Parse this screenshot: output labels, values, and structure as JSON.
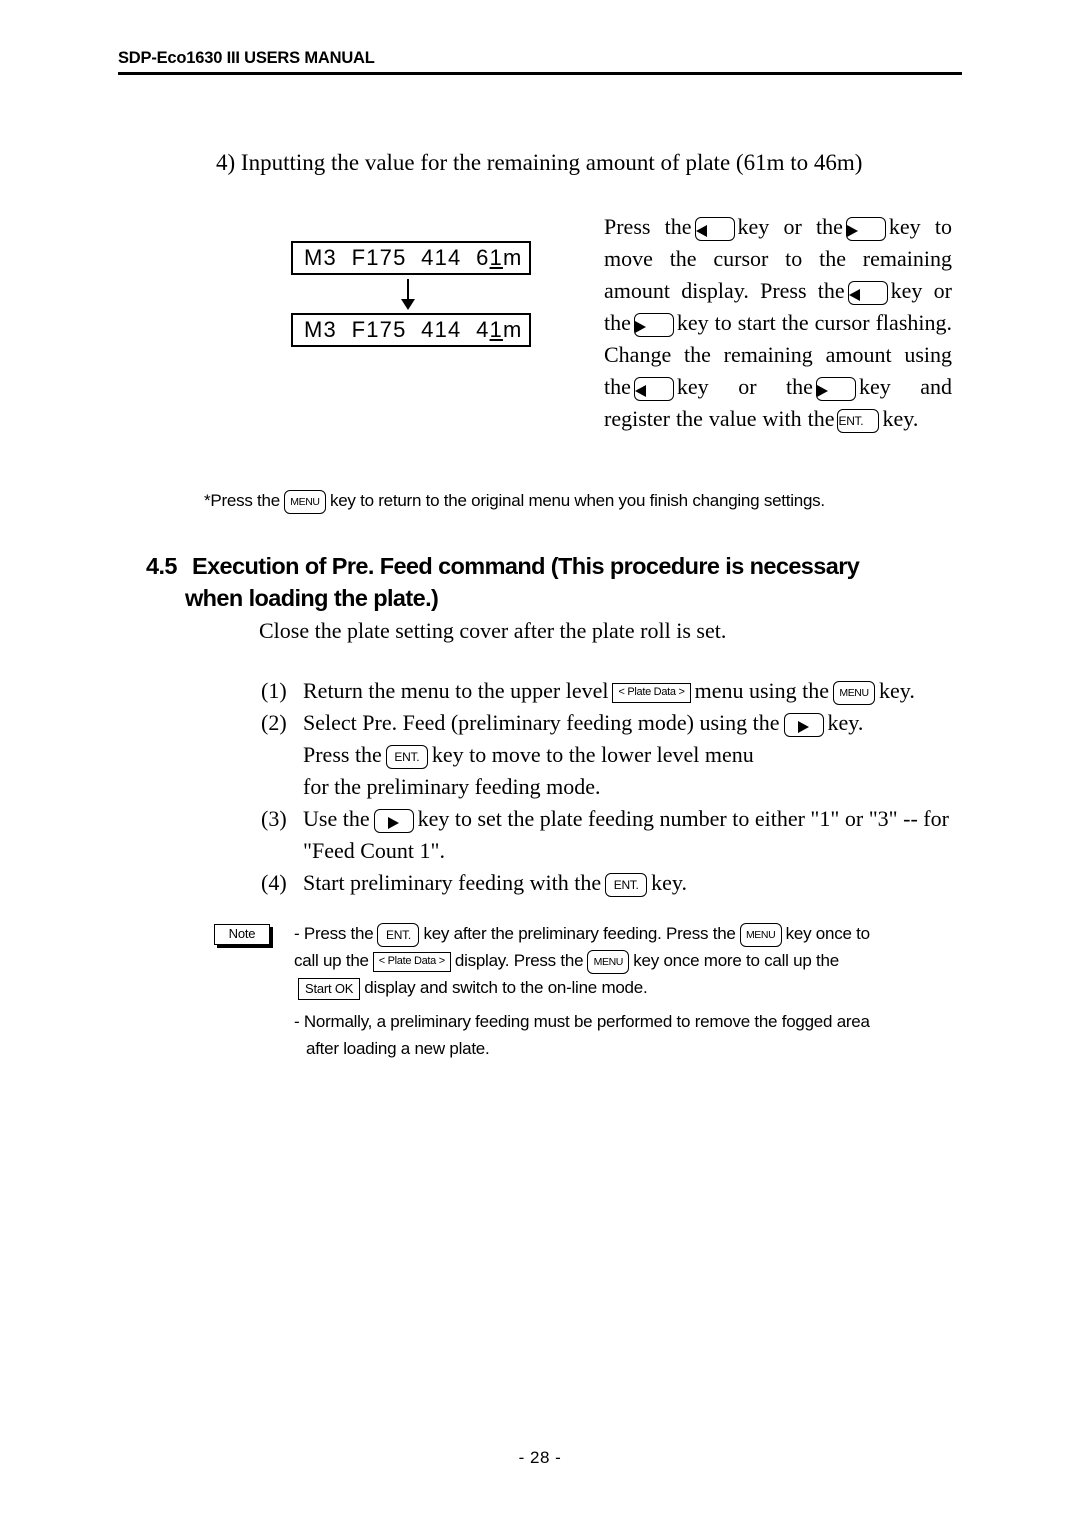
{
  "header": {
    "title": "SDP-Eco1630 III USERS MANUAL"
  },
  "section4": {
    "title": "4) Inputting the value for the remaining amount of plate (61m to 46m)"
  },
  "lcd": {
    "before": {
      "prefix": "M3  F175  414  6",
      "cursor": "1",
      "suffix": "m"
    },
    "after": {
      "prefix": "M3  F175  414  4",
      "cursor": "1",
      "suffix": "m"
    },
    "arrow_icon": "down-arrow-icon"
  },
  "press_paragraph": {
    "t1": "Press the",
    "t2": "key or the",
    "t3": "key to move the cursor to the remaining amount display.  Press the",
    "t4": "key or the",
    "t5": "key to start the cursor flashing.  Change the remaining amount using the",
    "t6": "key or the",
    "t7": "key and register the value with the",
    "t8": "key."
  },
  "menu_note": {
    "t1": "*Press the",
    "t2": "key to return to the original menu when you finish changing settings."
  },
  "heading45": {
    "number": "4.5",
    "line1": "Execution of Pre. Feed command (This procedure is necessary",
    "line2": "when loading the plate.)"
  },
  "intro_line": "Close the plate setting cover after the plate roll is set.",
  "steps": [
    {
      "num": "(1)",
      "t1": "Return the menu to the upper level",
      "t2": "menu using the",
      "t3": "key."
    },
    {
      "num": "(2)",
      "t1": "Select Pre. Feed (preliminary feeding mode) using the",
      "t2": "key.",
      "sub1": "Press the",
      "sub2": "key to move to the lower level menu",
      "sub3": "for the preliminary feeding mode."
    },
    {
      "num": "(3)",
      "t1": "Use the",
      "t2": "key to set the plate feeding number to either \"1\" or \"3\" -- for",
      "sub1": "\"Feed Count 1\"."
    },
    {
      "num": "(4)",
      "t1": "Start preliminary feeding with the",
      "t2": "key."
    }
  ],
  "note": {
    "badge": "Note",
    "line1a": "- Press the",
    "line1b": "key after the  preliminary feeding.  Press the",
    "line1c": "key once to",
    "line2a": "call up the",
    "line2b": "display.   Press the",
    "line2c": "key once more to call up the",
    "line3a": "display and switch to the on-line mode.",
    "tail1": "- Normally, a preliminary feeding must be performed to remove the fogged area",
    "tail2": "after loading a new plate."
  },
  "keys": {
    "left": "left-arrow-key",
    "right": "right-arrow-key",
    "ent": "ENT.",
    "menu": "MENU",
    "plate_data": "< Plate Data >",
    "start_ok": "Start OK"
  },
  "footer": {
    "page": "- 28 -"
  }
}
